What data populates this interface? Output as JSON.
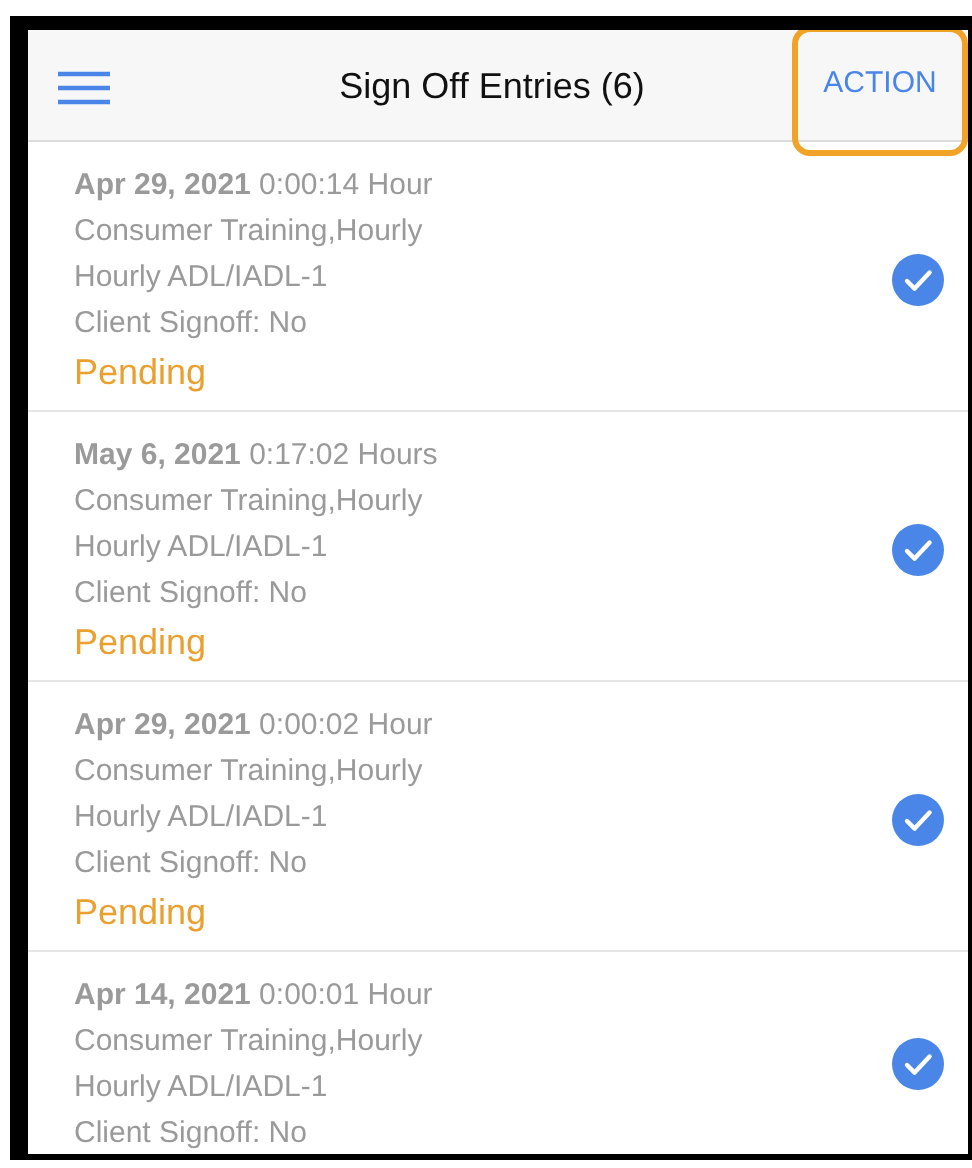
{
  "header": {
    "title": "Sign Off Entries (6)",
    "action": {
      "label": "ACTION",
      "highlighted": true
    }
  },
  "entries": [
    {
      "heading": "**Apr 29, 2021** 0:00:14 Hour",
      "service": "Consumer Training,Hourly",
      "code": "Hourly ADL/IADL-1",
      "signoff": "Client Signoff: No",
      "status": "Pending",
      "checked": true
    },
    {
      "heading": "**May 6, 2021** 0:17:02 Hours",
      "service": "Consumer Training,Hourly",
      "code": "Hourly ADL/IADL-1",
      "signoff": "Client Signoff: No",
      "status": "Pending",
      "checked": true
    },
    {
      "heading": "**Apr 29, 2021** 0:00:02 Hour",
      "service": "Consumer Training,Hourly",
      "code": "Hourly ADL/IADL-1",
      "signoff": "Client Signoff: No",
      "status": "Pending",
      "checked": true
    },
    {
      "heading": "**Apr 14, 2021** 0:00:01 Hour",
      "service": "Consumer Training,Hourly",
      "code": "Hourly ADL/IADL-1",
      "signoff": "Client Signoff: No",
      "checked": true
    }
  ]
}
